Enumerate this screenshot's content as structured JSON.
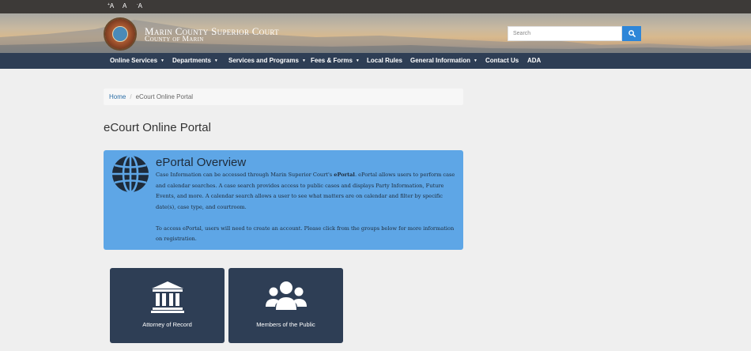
{
  "font_size_controls": [
    {
      "label": "A",
      "sup": "+"
    },
    {
      "label": "A",
      "sup": ""
    },
    {
      "label": "A",
      "sup": "-"
    }
  ],
  "header": {
    "title": "Marin County Superior Court",
    "subtitle": "County of Marin"
  },
  "search": {
    "placeholder": "Search",
    "icon": "search-icon"
  },
  "nav": {
    "items": [
      {
        "label": "Online Services",
        "dropdown": true
      },
      {
        "label": "Departments",
        "dropdown": true
      },
      {
        "label": "Services and Programs",
        "dropdown": true
      },
      {
        "label": "Fees & Forms",
        "dropdown": true
      },
      {
        "label": "Local Rules",
        "dropdown": false
      },
      {
        "label": "General Information",
        "dropdown": true
      },
      {
        "label": "Contact Us",
        "dropdown": false
      },
      {
        "label": "ADA",
        "dropdown": false
      }
    ]
  },
  "breadcrumb": {
    "home": "Home",
    "separator": "/",
    "current": "eCourt Online Portal"
  },
  "page_title": "eCourt Online Portal",
  "overview": {
    "icon": "globe-icon",
    "title": "ePortal Overview",
    "p1_before": "Case Information can be accessed through Marin Superior Court's ",
    "p1_bold": "ePortal",
    "p1_after": ".  ePortal allows users to perform case and calendar searches.  A case search provides access to public cases and displays Party Information, Future Events, and more.  A calendar search allows a user to see what matters are on calendar and filter by specific date(s), case type, and courtroom.",
    "p2": "To access ePortal, users will need to create an account.  Please click from the groups below for more information on registration."
  },
  "tiles": [
    {
      "label": "Attorney of Record",
      "icon": "courthouse-icon"
    },
    {
      "label": "Members of the Public",
      "icon": "group-icon"
    }
  ],
  "colors": {
    "nav_bg": "#2e3e55",
    "overview_bg": "#5ea6e6",
    "search_button": "#2e86d8",
    "link": "#2b6ea6"
  }
}
